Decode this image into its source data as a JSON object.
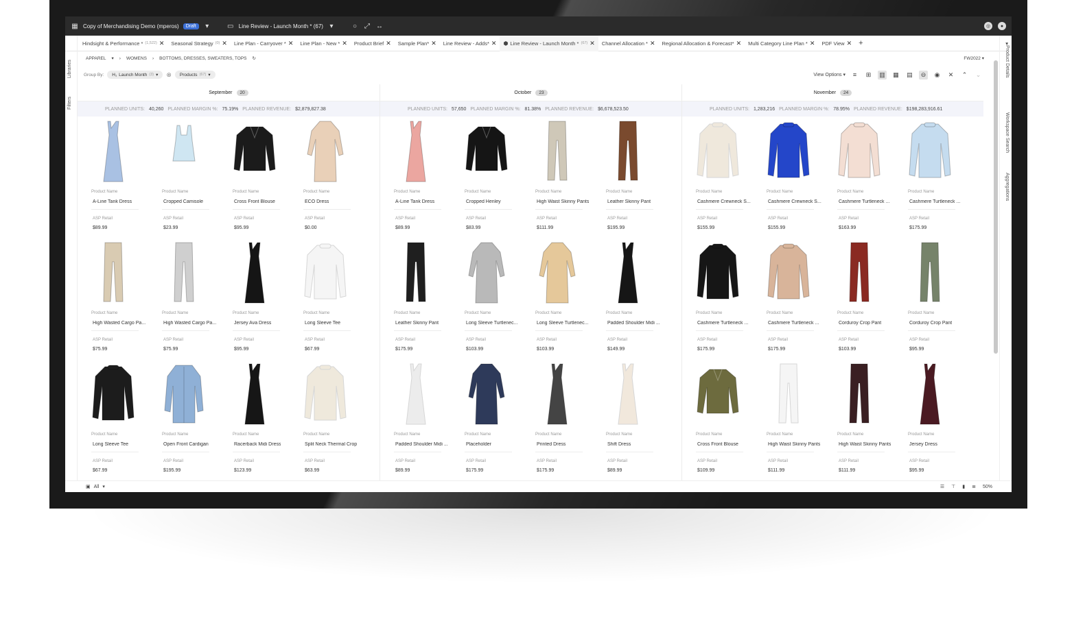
{
  "topbar": {
    "workspace": "Copy of Merchandising Demo (mperos)",
    "draft_badge": "Draft",
    "view": "Line Review - Launch Month * (67)"
  },
  "tabs": [
    {
      "label": "Hindsight & Performance *",
      "count": "(1,522)"
    },
    {
      "label": "Seasonal Strategy",
      "count": "(0)"
    },
    {
      "label": "Line Plan - Carryover *",
      "count": ""
    },
    {
      "label": "Line Plan - New *",
      "count": ""
    },
    {
      "label": "Product Brief",
      "count": ""
    },
    {
      "label": "Sample Plan*",
      "count": ""
    },
    {
      "label": "Line Review - Adds*",
      "count": ""
    },
    {
      "label": "Line Review - Launch Month *",
      "count": "(67)",
      "active": true
    },
    {
      "label": "Channel Allocation *",
      "count": ""
    },
    {
      "label": "Regional Allocation & Forecast*",
      "count": ""
    },
    {
      "label": "Multi Category Line Plan *",
      "count": ""
    },
    {
      "label": "PDF View",
      "count": ""
    }
  ],
  "rails": {
    "left": [
      "Libraries",
      "Filters"
    ],
    "right": [
      "Product Details",
      "Workspace Search",
      "Aggregations"
    ]
  },
  "breadcrumb": [
    "APPAREL",
    "WOMENS",
    "BOTTOMS, DRESSES, SWEATERS, TOPS"
  ],
  "season": "FW2022",
  "groupby": {
    "label": "Group By:",
    "chip1": "Launch Month",
    "chip1_count": "(3)",
    "chip2": "Products",
    "chip2_count": "(67)"
  },
  "toolbar": {
    "view_options": "View Options"
  },
  "labels": {
    "product_name": "Product Name",
    "asp_retail": "ASP Retail",
    "planned_units": "PLANNED UNITS:",
    "planned_margin": "PLANNED MARGIN %:",
    "planned_revenue": "PLANNED REVENUE:"
  },
  "months": [
    {
      "name": "September",
      "count": "20",
      "units": "40,260",
      "margin": "75.19%",
      "revenue": "$2,879,827.38",
      "products": [
        {
          "name": "A-Line Tank Dress",
          "price": "$89.99",
          "icon": "dress",
          "color": "#a9c1e3"
        },
        {
          "name": "Cropped Camisole",
          "price": "$23.99",
          "icon": "tank",
          "color": "#cfe6f2"
        },
        {
          "name": "Cross Front Blouse",
          "price": "$95.99",
          "icon": "blouse",
          "color": "#1b1b1b"
        },
        {
          "name": "ECO Dress",
          "price": "$0.00",
          "icon": "dress-sleeve",
          "color": "#e9d0b8"
        },
        {
          "name": "High Wasted Cargo Pa...",
          "price": "$75.99",
          "icon": "pants",
          "color": "#d9cbb2"
        },
        {
          "name": "High Wasted Cargo Pa...",
          "price": "$75.99",
          "icon": "pants",
          "color": "#cfcfcf"
        },
        {
          "name": "Jersey Ava Dress",
          "price": "$95.99",
          "icon": "dress",
          "color": "#151515"
        },
        {
          "name": "Long Sleeve Tee",
          "price": "$67.99",
          "icon": "sweater",
          "color": "#f5f5f5"
        },
        {
          "name": "Long Sleeve Tee",
          "price": "$67.99",
          "icon": "sweater",
          "color": "#1c1c1c"
        },
        {
          "name": "Open Front Cardigan",
          "price": "$195.99",
          "icon": "cardigan",
          "color": "#8fb0d6"
        },
        {
          "name": "Racerback Midi Dress",
          "price": "$123.99",
          "icon": "dress",
          "color": "#161616"
        },
        {
          "name": "Split Neck Thermal Crop",
          "price": "$63.99",
          "icon": "sweater",
          "color": "#efe9dc"
        }
      ]
    },
    {
      "name": "October",
      "count": "23",
      "units": "57,650",
      "margin": "81.38%",
      "revenue": "$6,678,523.50",
      "products": [
        {
          "name": "A-Line Tank Dress",
          "price": "$89.99",
          "icon": "dress",
          "color": "#eba6a0"
        },
        {
          "name": "Cropped Henley",
          "price": "$83.99",
          "icon": "blouse",
          "color": "#151515"
        },
        {
          "name": "High Waist Skinny Pants",
          "price": "$111.99",
          "icon": "pants",
          "color": "#cfc8b8"
        },
        {
          "name": "Leather Skinny Pant",
          "price": "$195.99",
          "icon": "pants",
          "color": "#7a4a2e"
        },
        {
          "name": "Leather Skinny Pant",
          "price": "$175.99",
          "icon": "pants",
          "color": "#1f1f1f"
        },
        {
          "name": "Long Sleeve Turtlenec...",
          "price": "$103.99",
          "icon": "dress-sleeve",
          "color": "#b9b9b9"
        },
        {
          "name": "Long Sleeve Turtlenec...",
          "price": "$103.99",
          "icon": "dress-sleeve",
          "color": "#e5c89a"
        },
        {
          "name": "Padded Shoulder Midi ...",
          "price": "$149.99",
          "icon": "dress",
          "color": "#161616"
        },
        {
          "name": "Padded Shoulder Midi ...",
          "price": "$89.99",
          "icon": "dress",
          "color": "#ececec"
        },
        {
          "name": "Placeholder",
          "price": "$175.99",
          "icon": "dress-sleeve",
          "color": "#2e3a5a"
        },
        {
          "name": "Printed Dress",
          "price": "$175.99",
          "icon": "dress",
          "color": "#444444"
        },
        {
          "name": "Shift Dress",
          "price": "$89.99",
          "icon": "dress",
          "color": "#f1e8dc"
        }
      ]
    },
    {
      "name": "November",
      "count": "24",
      "units": "1,283,216",
      "margin": "78.95%",
      "revenue": "$198,283,916.61",
      "products": [
        {
          "name": "Cashmere Crewneck S...",
          "price": "$155.99",
          "icon": "sweater",
          "color": "#efe8dc"
        },
        {
          "name": "Cashmere Crewneck S...",
          "price": "$155.99",
          "icon": "sweater",
          "color": "#2446c9"
        },
        {
          "name": "Cashmere Turtleneck ...",
          "price": "$163.99",
          "icon": "sweater",
          "color": "#f3ded3"
        },
        {
          "name": "Cashmere Turtleneck ...",
          "price": "$175.99",
          "icon": "sweater",
          "color": "#c5dcef"
        },
        {
          "name": "Cashmere Turtleneck ...",
          "price": "$175.99",
          "icon": "sweater",
          "color": "#161616"
        },
        {
          "name": "Cashmere Turtleneck ...",
          "price": "$175.99",
          "icon": "sweater",
          "color": "#d8b49a"
        },
        {
          "name": "Corduroy Crop Pant",
          "price": "$103.99",
          "icon": "pants",
          "color": "#8a2a22"
        },
        {
          "name": "Corduroy Crop Pant",
          "price": "$95.99",
          "icon": "pants",
          "color": "#76836a"
        },
        {
          "name": "Cross Front Blouse",
          "price": "$109.99",
          "icon": "blouse",
          "color": "#6d6b3e"
        },
        {
          "name": "High Waist Skinny Pants",
          "price": "$111.99",
          "icon": "pants",
          "color": "#f5f5f5"
        },
        {
          "name": "High Waist Skinny Pants",
          "price": "$111.99",
          "icon": "pants",
          "color": "#3a1f22"
        },
        {
          "name": "Jersey Dress",
          "price": "$95.99",
          "icon": "dress",
          "color": "#4a1a22"
        }
      ]
    }
  ],
  "bottombar": {
    "filter": "All",
    "zoom": "50%"
  }
}
